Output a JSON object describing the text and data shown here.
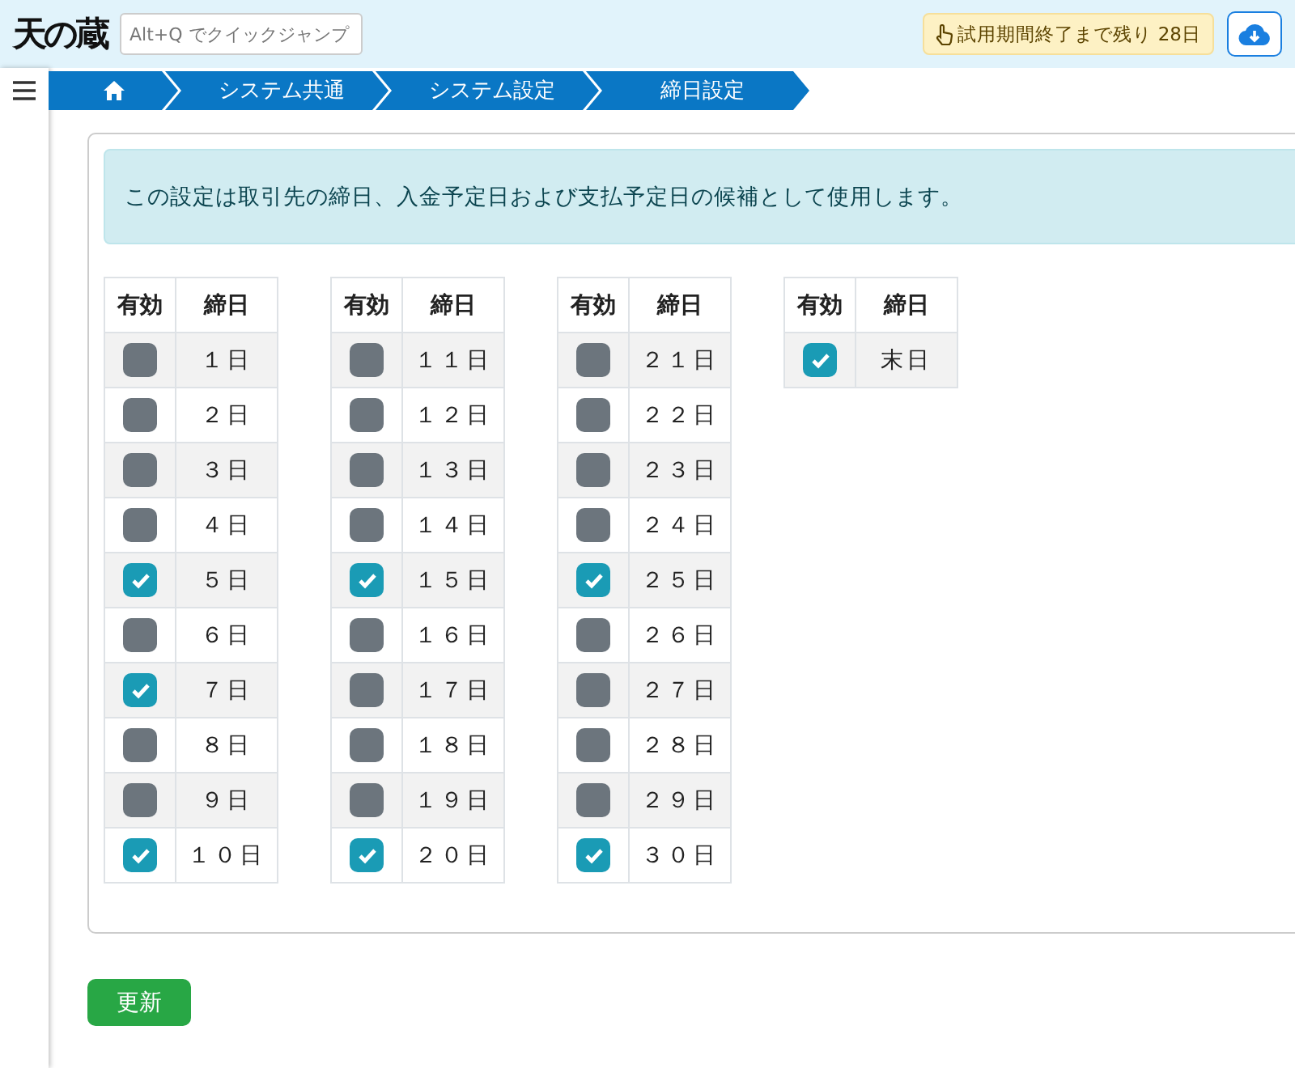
{
  "header": {
    "logo": "天の蔵",
    "quick_jump": {
      "placeholder": "Alt+Q でクイックジャンプ"
    },
    "trial_badge": "試用期間終了まで残り 28日"
  },
  "breadcrumb": [
    {
      "kind": "home"
    },
    {
      "kind": "text",
      "label": "システム共通"
    },
    {
      "kind": "text",
      "label": "システム設定"
    },
    {
      "kind": "text",
      "label": "締日設定"
    }
  ],
  "notice": "この設定は取引先の締日、入金予定日および支払予定日の候補として使用します。",
  "tables": [
    {
      "columns": [
        "有効",
        "締日"
      ],
      "rows": [
        {
          "day": "１日",
          "checked": false
        },
        {
          "day": "２日",
          "checked": false
        },
        {
          "day": "３日",
          "checked": false
        },
        {
          "day": "４日",
          "checked": false
        },
        {
          "day": "５日",
          "checked": true
        },
        {
          "day": "６日",
          "checked": false
        },
        {
          "day": "７日",
          "checked": true
        },
        {
          "day": "８日",
          "checked": false
        },
        {
          "day": "９日",
          "checked": false
        },
        {
          "day": "１０日",
          "checked": true
        }
      ]
    },
    {
      "columns": [
        "有効",
        "締日"
      ],
      "rows": [
        {
          "day": "１１日",
          "checked": false
        },
        {
          "day": "１２日",
          "checked": false
        },
        {
          "day": "１３日",
          "checked": false
        },
        {
          "day": "１４日",
          "checked": false
        },
        {
          "day": "１５日",
          "checked": true
        },
        {
          "day": "１６日",
          "checked": false
        },
        {
          "day": "１７日",
          "checked": false
        },
        {
          "day": "１８日",
          "checked": false
        },
        {
          "day": "１９日",
          "checked": false
        },
        {
          "day": "２０日",
          "checked": true
        }
      ]
    },
    {
      "columns": [
        "有効",
        "締日"
      ],
      "rows": [
        {
          "day": "２１日",
          "checked": false
        },
        {
          "day": "２２日",
          "checked": false
        },
        {
          "day": "２３日",
          "checked": false
        },
        {
          "day": "２４日",
          "checked": false
        },
        {
          "day": "２５日",
          "checked": true
        },
        {
          "day": "２６日",
          "checked": false
        },
        {
          "day": "２７日",
          "checked": false
        },
        {
          "day": "２８日",
          "checked": false
        },
        {
          "day": "２９日",
          "checked": false
        },
        {
          "day": "３０日",
          "checked": true
        }
      ]
    },
    {
      "columns": [
        "有効",
        "締日"
      ],
      "rows": [
        {
          "day": "末日",
          "checked": true
        }
      ]
    }
  ],
  "update_button": "更新"
}
